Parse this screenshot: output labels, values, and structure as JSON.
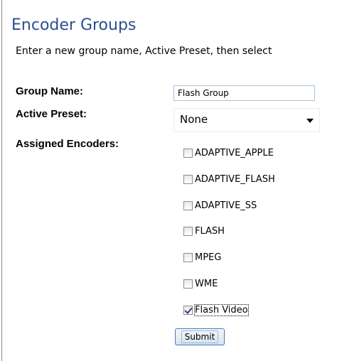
{
  "page": {
    "title": "Encoder Groups",
    "intro": "Enter a new group name, Active Preset, then select"
  },
  "form": {
    "group_name_label": "Group Name:",
    "group_name_value": "Flash Group",
    "active_preset_label": "Active Preset:",
    "active_preset_value": "None",
    "assigned_encoders_label": "Assigned Encoders:",
    "encoders": [
      {
        "label": "ADAPTIVE_APPLE",
        "checked": false
      },
      {
        "label": "ADAPTIVE_FLASH",
        "checked": false
      },
      {
        "label": "ADAPTIVE_SS",
        "checked": false
      },
      {
        "label": "FLASH",
        "checked": false
      },
      {
        "label": "MPEG",
        "checked": false
      },
      {
        "label": "WME",
        "checked": false
      },
      {
        "label": "Flash Video",
        "checked": true,
        "focused": true
      }
    ],
    "submit_label": "Submit"
  },
  "colors": {
    "title": "#2b4f90",
    "input_border": "#a8c4de",
    "button_border": "#4a7ab4"
  }
}
